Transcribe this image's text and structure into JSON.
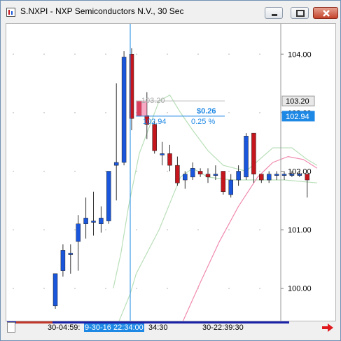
{
  "window": {
    "title": "S.NXPI - NXP Semiconductors N.V., 30 Sec"
  },
  "colors": {
    "up": "#1a56db",
    "down": "#c4161c",
    "crosshair": "#1e88e5",
    "ma_green": "#b9dfb9",
    "ma_pink": "#f08ab0"
  },
  "price_axis": {
    "labels": [
      "104.00",
      "103.00",
      "102.00",
      "101.00",
      "100.00"
    ],
    "tags": [
      {
        "label": "103.20",
        "style": "gray"
      },
      {
        "label": "102.94",
        "style": "blue"
      }
    ]
  },
  "time_axis": {
    "labels": [
      {
        "text": "30-04:59:",
        "kind": "normal"
      },
      {
        "text": "9-30-16 22:34:00",
        "kind": "cursor"
      },
      {
        "text": "34:30",
        "kind": "normal"
      },
      {
        "text": "30-22:39:30",
        "kind": "normal"
      }
    ]
  },
  "measure": {
    "start_price": "103.20",
    "end_price": "102.94",
    "change": "$0.26",
    "percent": "0.25 %"
  },
  "chart_data": {
    "type": "candlestick",
    "ylim": [
      99.65,
      104.35
    ],
    "yticks": [
      100,
      101,
      102,
      103,
      104
    ],
    "candles": [
      {
        "o": 99.7,
        "h": 100.25,
        "l": 99.65,
        "c": 100.25
      },
      {
        "o": 100.3,
        "h": 100.75,
        "l": 100.2,
        "c": 100.65
      },
      {
        "o": 100.6,
        "h": 100.75,
        "l": 100.25,
        "c": 100.6
      },
      {
        "o": 100.8,
        "h": 101.25,
        "l": 100.3,
        "c": 101.1
      },
      {
        "o": 101.1,
        "h": 101.55,
        "l": 100.85,
        "c": 101.2
      },
      {
        "o": 101.15,
        "h": 101.65,
        "l": 100.9,
        "c": 101.15
      },
      {
        "o": 101.1,
        "h": 101.4,
        "l": 100.95,
        "c": 101.2
      },
      {
        "o": 101.15,
        "h": 102.0,
        "l": 101.1,
        "c": 102.0
      },
      {
        "o": 102.1,
        "h": 103.5,
        "l": 101.5,
        "c": 102.15
      },
      {
        "o": 102.15,
        "h": 104.05,
        "l": 102.1,
        "c": 103.95
      },
      {
        "o": 104.0,
        "h": 104.1,
        "l": 102.7,
        "c": 102.9
      },
      {
        "o": 103.2,
        "h": 103.2,
        "l": 102.94,
        "c": 102.94
      },
      {
        "o": 102.95,
        "h": 103.35,
        "l": 102.55,
        "c": 102.8
      },
      {
        "o": 102.8,
        "h": 102.85,
        "l": 102.3,
        "c": 102.35
      },
      {
        "o": 102.3,
        "h": 102.5,
        "l": 102.1,
        "c": 102.3
      },
      {
        "o": 102.3,
        "h": 102.45,
        "l": 102.0,
        "c": 102.1
      },
      {
        "o": 102.1,
        "h": 102.25,
        "l": 101.75,
        "c": 101.8
      },
      {
        "o": 101.85,
        "h": 102.0,
        "l": 101.7,
        "c": 101.95
      },
      {
        "o": 101.9,
        "h": 102.15,
        "l": 101.85,
        "c": 102.05
      },
      {
        "o": 102.0,
        "h": 102.05,
        "l": 101.9,
        "c": 101.95
      },
      {
        "o": 101.95,
        "h": 102.05,
        "l": 101.8,
        "c": 101.9
      },
      {
        "o": 101.95,
        "h": 102.1,
        "l": 101.85,
        "c": 101.95
      },
      {
        "o": 102.0,
        "h": 102.0,
        "l": 101.6,
        "c": 101.65
      },
      {
        "o": 101.6,
        "h": 101.95,
        "l": 101.55,
        "c": 101.85
      },
      {
        "o": 101.85,
        "h": 102.1,
        "l": 101.75,
        "c": 102.0
      },
      {
        "o": 101.9,
        "h": 102.65,
        "l": 101.85,
        "c": 102.6
      },
      {
        "o": 102.65,
        "h": 102.65,
        "l": 101.8,
        "c": 101.95
      },
      {
        "o": 101.95,
        "h": 101.95,
        "l": 101.8,
        "c": 101.85
      },
      {
        "o": 101.85,
        "h": 102.0,
        "l": 101.8,
        "c": 101.95
      },
      {
        "o": 101.95,
        "h": 102.0,
        "l": 101.85,
        "c": 101.95
      },
      {
        "o": 101.95,
        "h": 102.0,
        "l": 101.85,
        "c": 101.95
      },
      {
        "o": 101.95,
        "h": 102.0,
        "l": 101.9,
        "c": 101.95
      },
      {
        "o": 101.95,
        "h": 102.0,
        "l": 101.9,
        "c": 101.95
      },
      {
        "o": 101.95,
        "h": 101.95,
        "l": 101.55,
        "c": 101.85
      }
    ],
    "ma_green_upper": [
      {
        "i": 7.6,
        "p": 100.0
      },
      {
        "i": 8.6,
        "p": 100.6
      },
      {
        "i": 9.6,
        "p": 101.4
      },
      {
        "i": 11.0,
        "p": 102.3
      },
      {
        "i": 13.6,
        "p": 103.2
      },
      {
        "i": 15.0,
        "p": 103.3
      },
      {
        "i": 16.4,
        "p": 103.0
      },
      {
        "i": 18.0,
        "p": 102.7
      },
      {
        "i": 20.0,
        "p": 102.35
      },
      {
        "i": 22.0,
        "p": 102.1
      },
      {
        "i": 25.0,
        "p": 102.0
      },
      {
        "i": 28.5,
        "p": 102.4
      },
      {
        "i": 31.0,
        "p": 102.4
      },
      {
        "i": 33.0,
        "p": 102.2
      },
      {
        "i": 34.3,
        "p": 102.1
      }
    ],
    "ma_green_lower": [
      {
        "i": 7.6,
        "p": 99.2
      },
      {
        "i": 9.8,
        "p": 99.9
      },
      {
        "i": 10.6,
        "p": 100.25
      },
      {
        "i": 13.6,
        "p": 101.0
      },
      {
        "i": 16.4,
        "p": 101.9
      },
      {
        "i": 18.0,
        "p": 102.05
      },
      {
        "i": 20.0,
        "p": 101.9
      },
      {
        "i": 23.0,
        "p": 101.85
      },
      {
        "i": 27.0,
        "p": 101.85
      },
      {
        "i": 30.0,
        "p": 101.85
      },
      {
        "i": 34.3,
        "p": 101.8
      }
    ],
    "ma_pink": [
      {
        "i": 16.6,
        "p": 99.4
      },
      {
        "i": 19.0,
        "p": 100.1
      },
      {
        "i": 21.5,
        "p": 100.8
      },
      {
        "i": 24.0,
        "p": 101.4
      },
      {
        "i": 26.5,
        "p": 101.9
      },
      {
        "i": 28.5,
        "p": 102.15
      },
      {
        "i": 30.5,
        "p": 102.25
      },
      {
        "i": 32.5,
        "p": 102.2
      },
      {
        "i": 34.3,
        "p": 102.05
      }
    ],
    "cursor_index": 10
  }
}
